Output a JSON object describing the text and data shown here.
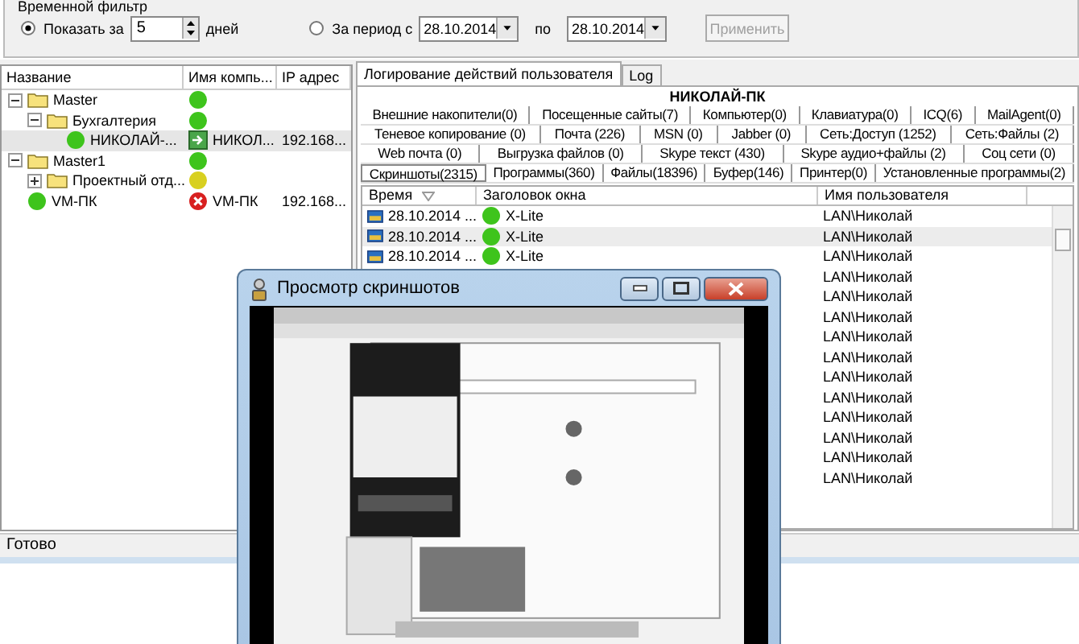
{
  "filter": {
    "title": "Временной фильтр",
    "options": [
      {
        "label": "Показать за",
        "selected": true
      },
      {
        "label": "За период с",
        "selected": false
      }
    ],
    "days": "5",
    "days_unit": "дней",
    "date_from": "28.10.2014",
    "to_label": "по",
    "date_to": "28.10.2014",
    "apply": {
      "label": "Применить",
      "disabled": true
    }
  },
  "tree": {
    "columns": [
      "Название",
      "Имя компь...",
      "IP адрес"
    ],
    "nodes": [
      {
        "kind": "folder",
        "name": "Master",
        "expanded": true,
        "color": "#3ec41c",
        "selected": false,
        "children": [
          {
            "kind": "folder",
            "name": "Бухгалтерия",
            "expanded": true,
            "color": "#3ec41c",
            "selected": false,
            "children": [
              {
                "kind": "computer",
                "name": "НИКОЛАЙ-...",
                "color": "#3ec41c",
                "host": "НИКОЛ...",
                "host_online": true,
                "ip": "192.168...",
                "selected": true
              }
            ]
          }
        ]
      },
      {
        "kind": "folder",
        "name": "Master1",
        "expanded": true,
        "color": "#3ec41c",
        "selected": false,
        "children": [
          {
            "kind": "folder",
            "name": "Проектный отд...",
            "expanded": false,
            "color": "#d8d020",
            "selected": false
          }
        ]
      },
      {
        "kind": "computer",
        "name": "VM-ПК",
        "color": "#3ec41c",
        "host": "VM-ПК",
        "host_online": false,
        "ip": "192.168...",
        "selected": false
      }
    ]
  },
  "main_tabs": [
    {
      "label": "Логирование действий пользователя",
      "selected": true
    },
    {
      "label": "Log",
      "selected": false
    }
  ],
  "computer_title": "НИКОЛАЙ-ПК",
  "category_tab_rows": [
    [
      {
        "label": "Внешние накопители(0)",
        "selected": false
      },
      {
        "label": "Посещенные сайты(7)",
        "selected": false
      },
      {
        "label": "Компьютер(0)",
        "selected": false
      },
      {
        "label": "Клавиатура(0)",
        "selected": false
      },
      {
        "label": "ICQ(6)",
        "selected": false
      },
      {
        "label": "MailAgent(0)",
        "selected": false
      }
    ],
    [
      {
        "label": "Теневое копирование (0)",
        "selected": false
      },
      {
        "label": "Почта (226)",
        "selected": false
      },
      {
        "label": "MSN (0)",
        "selected": false
      },
      {
        "label": "Jabber (0)",
        "selected": false
      },
      {
        "label": "Сеть:Доступ (1252)",
        "selected": false
      },
      {
        "label": "Сеть:Файлы (2)",
        "selected": false
      }
    ],
    [
      {
        "label": "Web почта (0)",
        "selected": false
      },
      {
        "label": "Выгрузка файлов (0)",
        "selected": false
      },
      {
        "label": "Skype текст (430)",
        "selected": false
      },
      {
        "label": "Skype аудио+файлы (2)",
        "selected": false
      },
      {
        "label": "Соц сети (0)",
        "selected": false
      }
    ],
    [
      {
        "label": "Скриншоты(2315)",
        "selected": true
      },
      {
        "label": "Программы(360)",
        "selected": false
      },
      {
        "label": "Файлы(18396)",
        "selected": false
      },
      {
        "label": "Буфер(146)",
        "selected": false
      },
      {
        "label": "Принтер(0)",
        "selected": false
      },
      {
        "label": "Установленные программы(2)",
        "selected": false
      }
    ]
  ],
  "table": {
    "columns": [
      "Время",
      "Заголовок окна",
      "Имя пользователя"
    ],
    "rows": [
      {
        "time": "28.10.2014 ...",
        "title": "X-Lite",
        "color": "#3ec41c",
        "user": "LAN\\Николай",
        "selected": false
      },
      {
        "time": "28.10.2014 ...",
        "title": "X-Lite",
        "color": "#3ec41c",
        "user": "LAN\\Николай",
        "selected": true
      },
      {
        "time": "28.10.2014 ...",
        "title": "X-Lite",
        "color": "#3ec41c",
        "user": "LAN\\Николай",
        "selected": false
      },
      {
        "user": "LAN\\Николай",
        "selected": false
      },
      {
        "user": "LAN\\Николай",
        "selected": false
      },
      {
        "user": "LAN\\Николай",
        "selected": false
      },
      {
        "user": "LAN\\Николай",
        "selected": false
      },
      {
        "user": "LAN\\Николай",
        "selected": false
      },
      {
        "user": "LAN\\Николай",
        "selected": false
      },
      {
        "user": "LAN\\Николай",
        "selected": false
      },
      {
        "user": "LAN\\Николай",
        "selected": false
      },
      {
        "user": "LAN\\Николай",
        "selected": false
      },
      {
        "user": "LAN\\Николай",
        "selected": false
      },
      {
        "user": "LAN\\Николай",
        "selected": false
      }
    ]
  },
  "status_bar": "Готово",
  "viewer": {
    "title": "Просмотр скриншотов"
  }
}
